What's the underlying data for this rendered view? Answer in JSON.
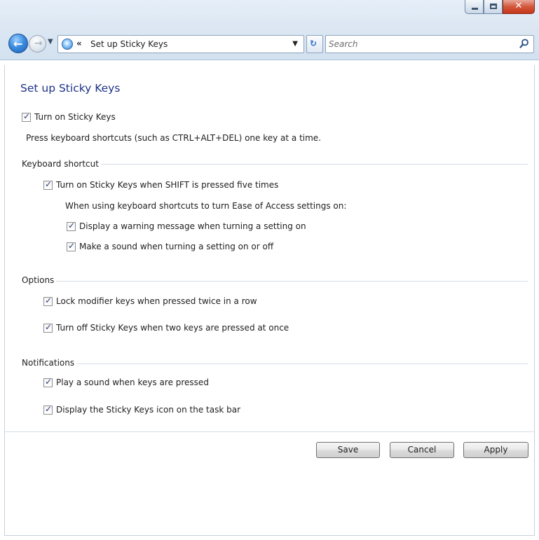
{
  "window": {
    "caption_buttons": [
      "minimize-icon",
      "maximize-icon",
      "close-icon"
    ]
  },
  "nav": {
    "breadcrumb_prefix": "«",
    "breadcrumb": "Set up Sticky Keys",
    "search_placeholder": "Search"
  },
  "page": {
    "title": "Set up Sticky Keys",
    "turn_on": {
      "label": "Turn on Sticky Keys",
      "checked": true
    },
    "turn_on_desc": "Press keyboard shortcuts (such as CTRL+ALT+DEL) one key at a time.",
    "keyboard_shortcut": {
      "heading": "Keyboard shortcut",
      "shift_five": {
        "label": "Turn on Sticky Keys when SHIFT is pressed five times",
        "checked": true
      },
      "info": "When using keyboard shortcuts to turn Ease of Access settings on:",
      "warning": {
        "label": "Display a warning message when turning a setting on",
        "checked": true
      },
      "sound": {
        "label": "Make a sound when turning a setting on or off",
        "checked": true
      }
    },
    "options": {
      "heading": "Options",
      "lock_modifier": {
        "label": "Lock modifier keys when pressed twice in a row",
        "checked": true
      },
      "turn_off_two": {
        "label": "Turn off Sticky Keys when two keys are pressed at once",
        "checked": true
      }
    },
    "notifications": {
      "heading": "Notifications",
      "play_sound": {
        "label": "Play a sound when keys are pressed",
        "checked": true
      },
      "display_icon": {
        "label": "Display the Sticky Keys icon on the task bar",
        "checked": true
      }
    }
  },
  "buttons": {
    "save": "Save",
    "cancel": "Cancel",
    "apply": "Apply"
  }
}
